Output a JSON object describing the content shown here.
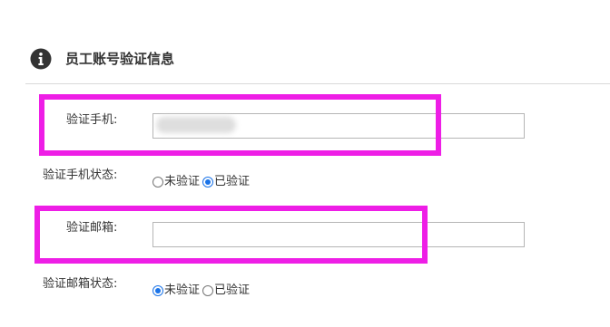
{
  "section": {
    "icon": "info-circle-icon",
    "title": "员工账号验证信息"
  },
  "colors": {
    "highlight": "#ee1ee6",
    "radio_checked": "#1a73e8"
  },
  "fields": {
    "phone": {
      "label": "验证手机:",
      "value": ""
    },
    "phone_status": {
      "label": "验证手机状态:",
      "options": [
        "未验证",
        "已验证"
      ],
      "selected": "已验证"
    },
    "email": {
      "label": "验证邮箱:",
      "value": ""
    },
    "email_status": {
      "label": "验证邮箱状态:",
      "options": [
        "未验证",
        "已验证"
      ],
      "selected": "未验证"
    }
  }
}
